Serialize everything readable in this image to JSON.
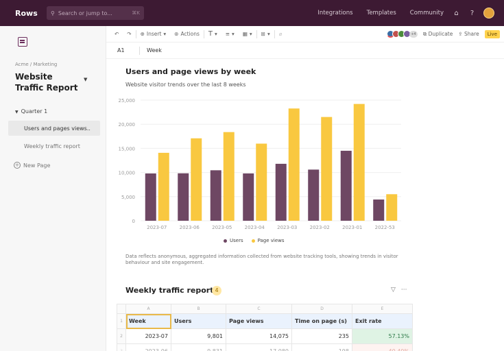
{
  "topbar": {
    "logo": "Rows",
    "search_placeholder": "Search or jump to...",
    "search_shortcut": "⌘K",
    "links": [
      "Integrations",
      "Templates",
      "Community"
    ]
  },
  "sidebar": {
    "breadcrumb": "Acme / Marketing",
    "title": "Website Traffic Report",
    "section": "Quarter 1",
    "items": [
      {
        "label": "Users and pages views..",
        "active": true
      },
      {
        "label": "Weekly traffic report",
        "active": false
      }
    ],
    "new_page": "New Page"
  },
  "toolbar": {
    "insert": "Insert",
    "actions": "Actions",
    "avatar_count": "+4",
    "duplicate": "Duplicate",
    "share": "Share",
    "live": "Live"
  },
  "formula": {
    "cell_ref": "A1",
    "value": "Week"
  },
  "chart_data": {
    "type": "bar",
    "title": "Users and page views by week",
    "subtitle": "Website visitor trends over the last 8 weeks",
    "categories": [
      "2023-07",
      "2023-06",
      "2023-05",
      "2023-04",
      "2023-03",
      "2023-02",
      "2023-01",
      "2022-53"
    ],
    "series": [
      {
        "name": "Users",
        "color": "#6e4763",
        "values": [
          9801,
          9831,
          10460,
          9806,
          11800,
          10600,
          14500,
          4400
        ]
      },
      {
        "name": "Page views",
        "color": "#f9c840",
        "values": [
          14075,
          17080,
          18370,
          15980,
          23260,
          21500,
          24200,
          5500
        ]
      }
    ],
    "yticks": [
      "25,000",
      "20,000",
      "15,000",
      "10,000",
      "5,000",
      "0"
    ],
    "ylim": [
      0,
      25000
    ],
    "legend_position": "bottom",
    "grid": true
  },
  "chart_note": "Data reflects anonymous, aggregated information collected from website tracking tools, showing trends in visitor behaviour and site engagement.",
  "table": {
    "title": "Weekly traffic report",
    "badge": "4",
    "col_letters": [
      "A",
      "B",
      "C",
      "D",
      "E"
    ],
    "headers": [
      "Week",
      "Users",
      "Page views",
      "Time on page (s)",
      "Exit rate"
    ],
    "rows": [
      [
        "2023-07",
        "9,801",
        "14,075",
        "235",
        "57.13%"
      ],
      [
        "2023-06",
        "9,831",
        "17,080",
        "198",
        "40.40%"
      ]
    ],
    "row_numbers": [
      "1",
      "2",
      "3"
    ]
  }
}
